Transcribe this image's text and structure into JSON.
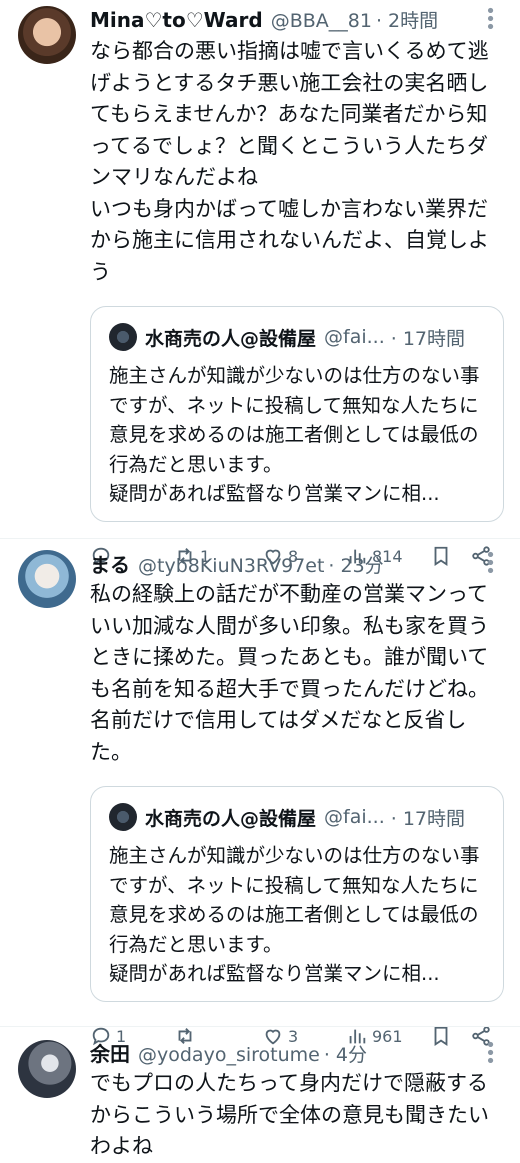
{
  "tweets": [
    {
      "name": "Mina♡to♡Ward",
      "handle": "@BBA__81",
      "time": "· 2時間",
      "text": "なら都合の悪い指摘は嘘で言いくるめて逃げようとするタチ悪い施工会社の実名晒してもらえませんか？あなた同業者だから知ってるでしょ？と聞くとこういう人たちダンマリなんだよね\nいつも身内かばって嘘しか言わない業界だから施主に信用されないんだよ、自覚しよう",
      "quote": {
        "name": "水商売の人@設備屋",
        "handle": "@fai...",
        "time": "· 17時間",
        "text": "施主さんが知識が少ないのは仕方のない事ですが、ネットに投稿して無知な人たちに意見を求めるのは施工者側としては最低の行為だと思います。\n疑問があれば監督なり営業マンに相..."
      },
      "replies": "",
      "retweets": "1",
      "likes": "8",
      "views": "814"
    },
    {
      "name": "まる",
      "handle": "@tyb8KiuN3RV97et",
      "time": "· 23分",
      "text": "私の経験上の話だが不動産の営業マンっていい加減な人間が多い印象。私も家を買うときに揉めた。買ったあとも。誰が聞いても名前を知る超大手で買ったんだけどね。名前だけで信用してはダメだなと反省した。",
      "quote": {
        "name": "水商売の人@設備屋",
        "handle": "@fai...",
        "time": "· 17時間",
        "text": "施主さんが知識が少ないのは仕方のない事ですが、ネットに投稿して無知な人たちに意見を求めるのは施工者側としては最低の行為だと思います。\n疑問があれば監督なり営業マンに相..."
      },
      "replies": "1",
      "retweets": "",
      "likes": "3",
      "views": "961"
    },
    {
      "name": "余田",
      "handle": "@yodayo_sirotume",
      "time": "· 4分",
      "text": "でもプロの人たちって身内だけで隠蔽するからこういう場所で全体の意見も聞きたいわよね"
    }
  ]
}
